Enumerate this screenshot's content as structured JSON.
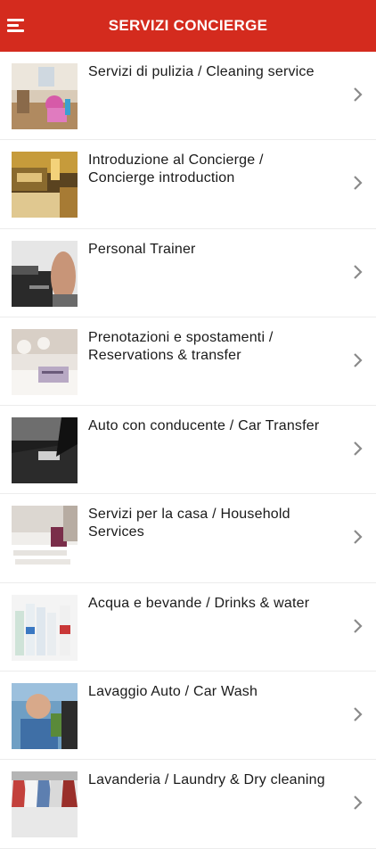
{
  "header": {
    "title": "SERVIZI CONCIERGE",
    "background": "#d42b1e"
  },
  "icons": {
    "menu": "hamburger-menu-icon",
    "chevron": "chevron-right-icon"
  },
  "items": [
    {
      "label": "Servizi di pulizia / Cleaning service",
      "thumb": "cleaning-service-photo"
    },
    {
      "label": "Introduzione al Concierge / Concierge introduction",
      "thumb": "concierge-photo"
    },
    {
      "label": "Personal Trainer",
      "thumb": "personal-trainer-photo"
    },
    {
      "label": "Prenotazioni e spostamenti / Reservations & transfer",
      "thumb": "reservation-photo"
    },
    {
      "label": "Auto con conducente / Car Transfer",
      "thumb": "car-transfer-photo"
    },
    {
      "label": "Servizi per la casa / Household Services",
      "thumb": "household-photo"
    },
    {
      "label": "Acqua e bevande / Drinks & water",
      "thumb": "drinks-photo"
    },
    {
      "label": "Lavaggio Auto / Car Wash",
      "thumb": "car-wash-photo"
    },
    {
      "label": "Lavanderia / Laundry & Dry cleaning",
      "thumb": "laundry-photo"
    }
  ]
}
